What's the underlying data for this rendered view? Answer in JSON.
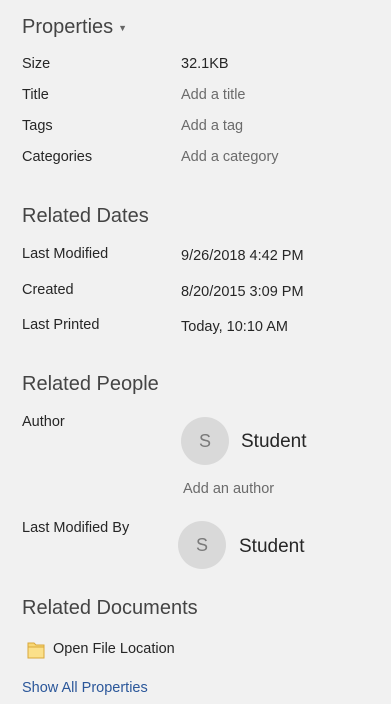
{
  "properties": {
    "heading": "Properties",
    "caret_icon": "caret-down-icon",
    "items": [
      {
        "label": "Size",
        "value": "32.1KB",
        "editable": false
      },
      {
        "label": "Title",
        "value": "Add a title",
        "editable": true
      },
      {
        "label": "Tags",
        "value": "Add a tag",
        "editable": true
      },
      {
        "label": "Categories",
        "value": "Add a category",
        "editable": true
      }
    ]
  },
  "related_dates": {
    "heading": "Related Dates",
    "items": [
      {
        "label": "Last Modified",
        "value": "9/26/2018 4:42 PM"
      },
      {
        "label": "Created",
        "value": "8/20/2015 3:09 PM"
      },
      {
        "label": "Last Printed",
        "value": "Today, 10:10 AM"
      }
    ]
  },
  "related_people": {
    "heading": "Related People",
    "author": {
      "label": "Author",
      "initial": "S",
      "name": "Student",
      "add_label": "Add an author"
    },
    "last_modified_by": {
      "label": "Last Modified By",
      "initial": "S",
      "name": "Student"
    }
  },
  "related_documents": {
    "heading": "Related Documents",
    "open_file_location": "Open File Location",
    "folder_icon": "folder-icon",
    "folder_color": "#f8d775"
  },
  "show_all_properties": "Show All Properties",
  "colors": {
    "background": "#f1f1f1",
    "link": "#2b579a",
    "avatar": "#d9d9d9"
  }
}
